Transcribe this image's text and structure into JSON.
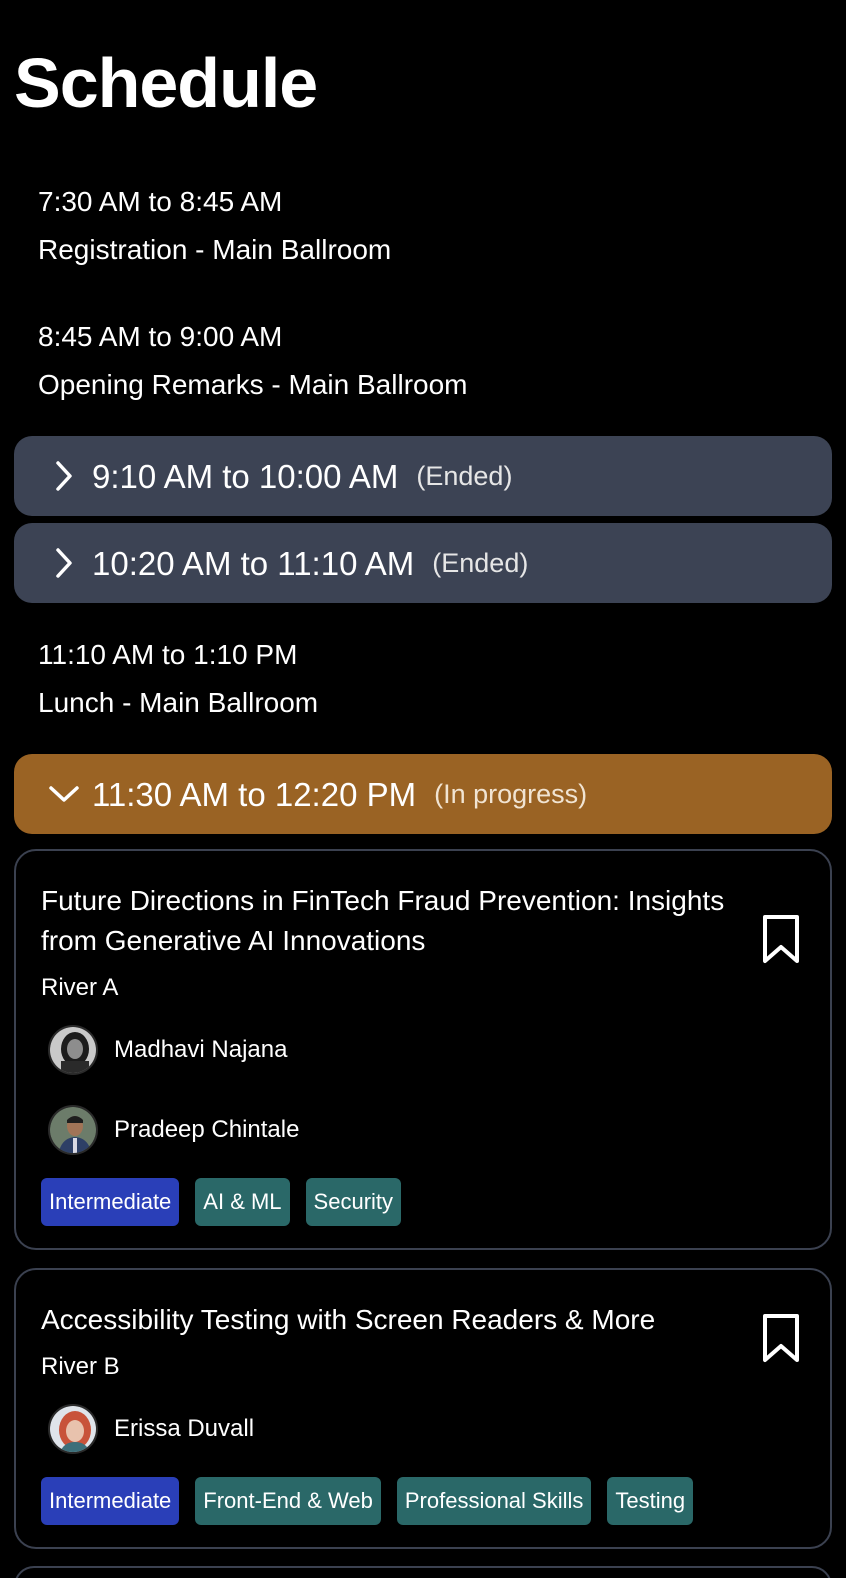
{
  "page": {
    "title": "Schedule"
  },
  "plain_slots": [
    {
      "time": "7:30 AM to 8:45 AM",
      "desc": "Registration - Main Ballroom"
    },
    {
      "time": "8:45 AM to 9:00 AM",
      "desc": "Opening Remarks - Main Ballroom"
    },
    {
      "time": "11:10 AM to 1:10 PM",
      "desc": "Lunch - Main Ballroom"
    }
  ],
  "session_slots": [
    {
      "time": "9:10 AM to 10:00 AM",
      "status": "(Ended)",
      "expanded": false
    },
    {
      "time": "10:20 AM to 11:10 AM",
      "status": "(Ended)",
      "expanded": false
    },
    {
      "time": "11:30 AM to 12:20 PM",
      "status": "(In progress)",
      "expanded": true
    }
  ],
  "sessions": [
    {
      "title": "Future Directions in FinTech Fraud Prevention: Insights from Generative AI Innovations",
      "room": "River A",
      "speakers": [
        {
          "name": "Madhavi Najana"
        },
        {
          "name": "Pradeep Chintale"
        }
      ],
      "level": "Intermediate",
      "topics": [
        "AI & ML",
        "Security"
      ]
    },
    {
      "title": "Accessibility Testing with Screen Readers & More",
      "room": "River B",
      "speakers": [
        {
          "name": "Erissa Duvall"
        }
      ],
      "level": "Intermediate",
      "topics": [
        "Front-End & Web",
        "Professional Skills",
        "Testing"
      ]
    }
  ],
  "icons": {
    "collapsed": "chevron-right-icon",
    "expanded": "chevron-down-icon",
    "bookmark": "bookmark-icon"
  },
  "colors": {
    "background": "#000000",
    "ended_bar": "#3c4354",
    "in_progress_bar": "#9a6324",
    "level_tag": "#2a3fb8",
    "topic_tag": "#2a6868"
  }
}
